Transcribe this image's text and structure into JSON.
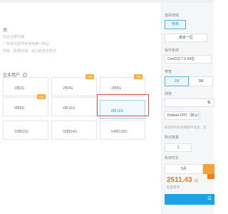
{
  "left": {
    "section_title": "器",
    "desc_lines": [
      "应企业服务器",
      "广有率内部项目使用推介购业",
      "网络、数据处理、动力后安全防护"
    ],
    "recommend_title": "企业用户",
    "info_icon": "info-icon",
    "cards": [
      {
        "label": "1核2G",
        "hot": false
      },
      {
        "label": "2核4G",
        "hot": true
      },
      {
        "label": "2核8G",
        "hot": true
      },
      {
        "label": "4核8G",
        "hot": true
      },
      {
        "label": "4核16G",
        "hot": false
      },
      {
        "label": "8核16G",
        "hot": false,
        "selected": true
      },
      {
        "label": "16核32G",
        "hot": false
      },
      {
        "label": "32核64G",
        "hot": false
      },
      {
        "label": "64核128G",
        "hot": false
      }
    ],
    "hot_badge": "Hot"
  },
  "right": {
    "region_label": "基础地域",
    "region_buttons": [
      "南京",
      "南京一区"
    ],
    "os_label": "操作系统",
    "os_value": "CentOS 7.5 64位",
    "bandwidth_label": "带宽",
    "bandwidth_options": [
      "1M",
      "3M"
    ],
    "network_label": "网络",
    "network_tag": "私",
    "vpc_value": "Default-VPC（默认）",
    "vpc_hint": "如现有的私有网络不合适，您",
    "qty_label": "购买数量",
    "qty_value": "1",
    "period_label": "购买时长",
    "period_value": "6月",
    "price_value": "2511.43",
    "price_unit": "元",
    "price_sub": "配置费用",
    "buy_button": "立"
  }
}
